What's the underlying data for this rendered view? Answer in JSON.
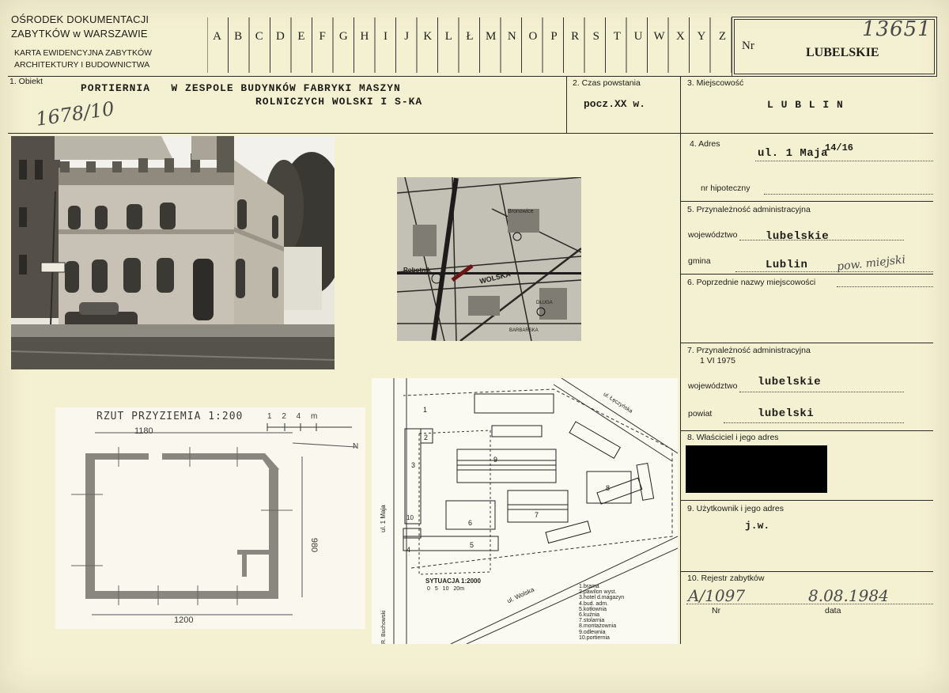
{
  "header": {
    "institution_line1": "OŚRODEK DOKUMENTACJI",
    "institution_line2": "ZABYTKÓW w WARSZAWIE",
    "card_line1": "KARTA EWIDENCYJNA ZABYTKÓW",
    "card_line2": "ARCHITEKTURY I BUDOWNICTWA",
    "alphabet": [
      "A",
      "B",
      "C",
      "D",
      "E",
      "F",
      "G",
      "H",
      "I",
      "J",
      "K",
      "L",
      "Ł",
      "M",
      "N",
      "O",
      "P",
      "R",
      "S",
      "T",
      "U",
      "W",
      "X",
      "Y",
      "Z"
    ],
    "nr_label": "Nr",
    "region": "LUBELSKIE",
    "handwritten_number": "13651"
  },
  "section1": {
    "label": "1. Obiekt",
    "line1": "PORTIERNIA   W ZESPOLE BUDYNKÓW FABRYKI MASZYN",
    "line2": "ROLNICZYCH WOLSKI I S-KA",
    "handwritten_ref": "1678/10"
  },
  "section2": {
    "label": "2. Czas powstania",
    "value": "pocz.XX w."
  },
  "section3": {
    "label": "3. Miejscowość",
    "value": "L U B L I N"
  },
  "section4": {
    "label": "4. Adres",
    "value": "ul. 1 Maja",
    "number": "14/16",
    "nr_hip_label": "nr hipoteczny"
  },
  "section5": {
    "label": "5. Przynależność administracyjna",
    "woj_label": "województwo",
    "woj_value": "lubelskie",
    "gmina_label": "gmina",
    "gmina_value": "Lublin",
    "gmina_note": "pow. miejski"
  },
  "section6": {
    "label": "6. Poprzednie nazwy miejscowości"
  },
  "section7": {
    "label": "7. Przynależność administracyjna",
    "date": "1 VI 1975",
    "woj_label": "województwo",
    "woj_value": "lubelskie",
    "powiat_label": "powiat",
    "powiat_value": "lubelski"
  },
  "section8": {
    "label": "8. Właściciel i jego adres"
  },
  "section9": {
    "label": "9. Użytkownik i jego adres",
    "value": "j.w."
  },
  "section10": {
    "label": "10. Rejestr zabytków",
    "nr_label": "Nr",
    "nr_value": "A/1097",
    "data_label": "data",
    "data_value": "8.08.1984"
  },
  "map": {
    "labels": [
      "WOLSKA",
      "Robotnik",
      "BARBARSKA",
      "Bronowice",
      "DŁUGA"
    ]
  },
  "floorplan": {
    "title": "RZUT PRZYZIEMIA 1:200",
    "scale": "1 2 4 m",
    "dim_top": "1180",
    "dim_bottom": "1200",
    "dim_right": "980",
    "north": "N"
  },
  "siteplan": {
    "title": "SYTUACJA 1:2000",
    "scale": "0 5 10 20m",
    "street1": "ul. 1 Maja",
    "street2": "ul. Wolska",
    "street3": "ul. Łęczyńska",
    "street4": "R. Buchowski",
    "legend": [
      "1.brama",
      "2.pawilon wyst.",
      "3.hotel d.magazyn",
      "4.bud. adm.",
      "5.kotłownia",
      "6.kuźnia",
      "7.stolarnia",
      "8.montażownia",
      "9.odlewnia",
      "10.portiernia"
    ],
    "numbers": [
      "1",
      "2",
      "3",
      "4",
      "5",
      "6",
      "7",
      "8",
      "9",
      "10"
    ]
  }
}
